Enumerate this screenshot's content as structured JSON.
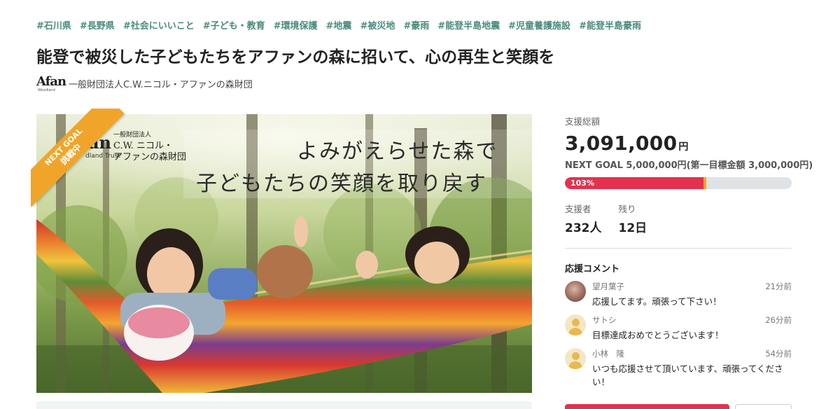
{
  "tags": [
    "#石川県",
    "#長野県",
    "#社会にいいこと",
    "#子ども・教育",
    "#環境保護",
    "#地震",
    "#被災地",
    "#豪雨",
    "#能登半島地震",
    "#児童養護施設",
    "#能登半島豪雨"
  ],
  "title": "能登で被災した子どもたちをアファンの森に招いて、心の再生と笑顔を",
  "organization": {
    "name": "一般財団法人C.W.ニコル・アファンの森財団",
    "logo_text": "Afan",
    "logo_sub": "Woodland"
  },
  "hero": {
    "ribbon_line1": "NEXT GOAL",
    "ribbon_line2": "挑戦中",
    "headline_1": "よみがえらせた森で",
    "headline_2": "子どもたちの笑顔を取り戻す",
    "org_line1": "一般財団法人",
    "org_line2": "C.W. ニコル・",
    "org_line3": "アファンの森財団",
    "logo_big": "an",
    "logo_sub": "dland Trust"
  },
  "funding": {
    "total_label": "支援総額",
    "total_amount": "3,091,000",
    "total_unit": "円",
    "next_goal": "NEXT GOAL 5,000,000円(第一目標金額 3,000,000円)",
    "progress_label": "103%",
    "progress_fraction": 0.6182,
    "supporters_label": "支援者",
    "supporters_value": "232人",
    "remaining_label": "残り",
    "remaining_value": "12日"
  },
  "comments": {
    "title": "応援コメント",
    "items": [
      {
        "name": "望月葉子",
        "time": "21分前",
        "text": "応援してます。頑張って下さい！",
        "avatar": "photo"
      },
      {
        "name": "サトシ",
        "time": "26分前",
        "text": "目標達成おめでとうございます！",
        "avatar": "default"
      },
      {
        "name": "小林　隆",
        "time": "54分前",
        "text": "いつも応援させて頂いています、頑張ってください！",
        "avatar": "default"
      }
    ]
  },
  "colors": {
    "accent": "#e4314f",
    "tag": "#4b8a7d",
    "ribbon": "#f0a52a"
  }
}
